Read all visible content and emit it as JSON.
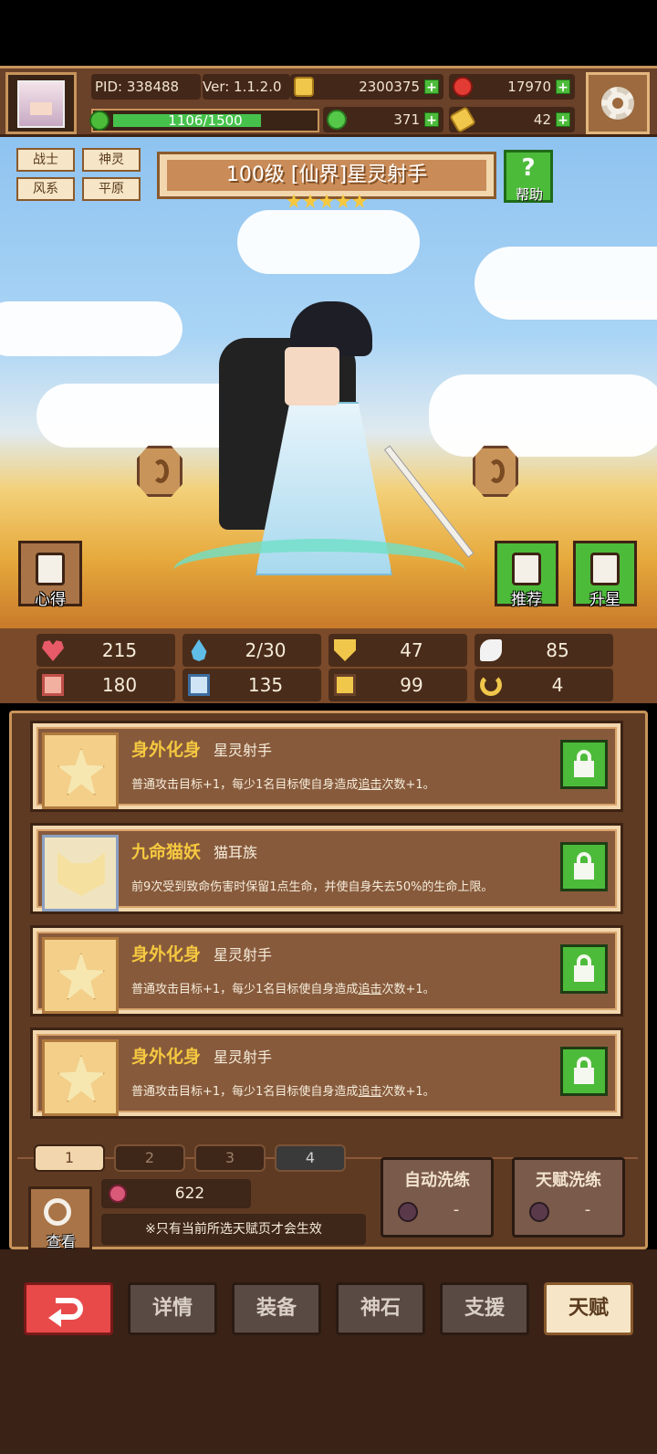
{
  "header": {
    "pid": "PID: 338488",
    "version": "Ver: 1.1.2.0",
    "gold": "2300375",
    "gems": "17970",
    "xp": "1106/1500",
    "xp_fraction": 0.737,
    "clover": "371",
    "ticket": "42",
    "plus": "+"
  },
  "hero": {
    "tags": [
      "战士",
      "神灵",
      "风系",
      "平原"
    ],
    "title": "100级 [仙界]星灵射手",
    "stars": 5,
    "help_label": "帮助",
    "help_symbol": "?"
  },
  "side_buttons": {
    "xinde": "心得",
    "tuijian": "推荐",
    "shengxing": "升星"
  },
  "stats": [
    {
      "icon": "heart-icon",
      "value": "215"
    },
    {
      "icon": "drop-icon",
      "value": "2/30"
    },
    {
      "icon": "shield-icon",
      "value": "47"
    },
    {
      "icon": "wing-icon",
      "value": "85"
    },
    {
      "icon": "fist-icon",
      "value": "180"
    },
    {
      "icon": "book-icon",
      "value": "135"
    },
    {
      "icon": "boot-icon",
      "value": "99"
    },
    {
      "icon": "horseshoe-icon",
      "value": "4"
    }
  ],
  "talents": [
    {
      "name": "身外化身",
      "sub": "星灵射手",
      "desc_pre": "普通攻击目标+1，每少1名目标使自身造成",
      "desc_link": "追击",
      "desc_post": "次数+1。"
    },
    {
      "name": "九命猫妖",
      "sub": "猫耳族",
      "desc_pre": "前9次受到致命伤害时保留1点生命，并使自身失去50%的生命上限。",
      "desc_link": "",
      "desc_post": ""
    },
    {
      "name": "身外化身",
      "sub": "星灵射手",
      "desc_pre": "普通攻击目标+1，每少1名目标使自身造成",
      "desc_link": "追击",
      "desc_post": "次数+1。"
    },
    {
      "name": "身外化身",
      "sub": "星灵射手",
      "desc_pre": "普通攻击目标+1，每少1名目标使自身造成",
      "desc_link": "追击",
      "desc_post": "次数+1。"
    }
  ],
  "pages": [
    "1",
    "2",
    "3",
    "4"
  ],
  "bottom_panel": {
    "view_label": "查看",
    "berry_count": "622",
    "hint": "※只有当前所选天赋页才会生效",
    "auto_wash": "自动洗练",
    "talent_wash": "天赋洗练",
    "cost": "-"
  },
  "nav": {
    "details": "详情",
    "equip": "装备",
    "stone": "神石",
    "support": "支援",
    "talent": "天赋"
  }
}
